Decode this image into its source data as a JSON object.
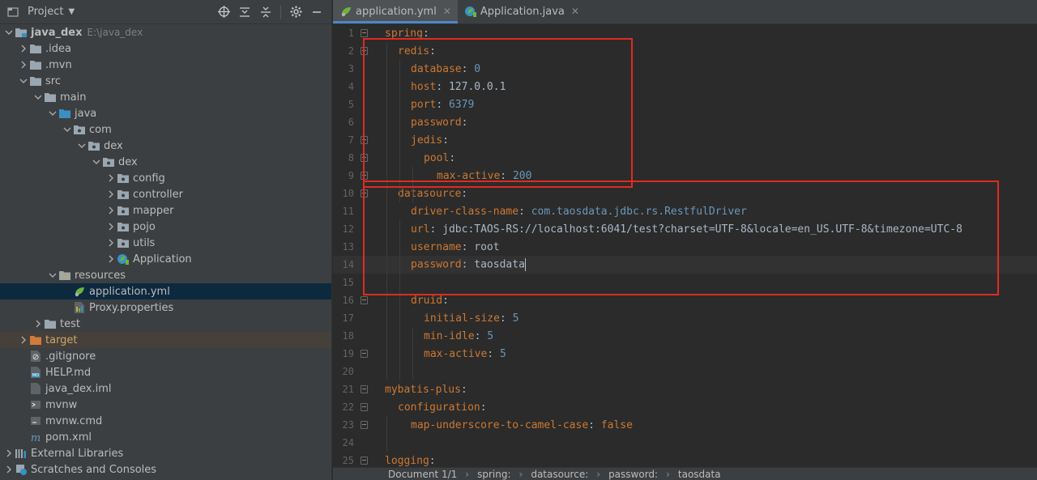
{
  "project_panel": {
    "title": "Project",
    "tree": [
      {
        "label": "java_dex",
        "path": "E:\\java_dex",
        "depth": 0,
        "expanded": true,
        "icon": "module-folder-icon",
        "bold": true
      },
      {
        "label": ".idea",
        "depth": 1,
        "expanded": false,
        "icon": "folder-icon"
      },
      {
        "label": ".mvn",
        "depth": 1,
        "expanded": false,
        "icon": "folder-icon"
      },
      {
        "label": "src",
        "depth": 1,
        "expanded": true,
        "icon": "folder-icon"
      },
      {
        "label": "main",
        "depth": 2,
        "expanded": true,
        "icon": "folder-icon"
      },
      {
        "label": "java",
        "depth": 3,
        "expanded": true,
        "icon": "source-folder-icon"
      },
      {
        "label": "com",
        "depth": 4,
        "expanded": true,
        "icon": "package-icon"
      },
      {
        "label": "dex",
        "depth": 5,
        "expanded": true,
        "icon": "package-icon"
      },
      {
        "label": "dex",
        "depth": 6,
        "expanded": true,
        "icon": "package-icon"
      },
      {
        "label": "config",
        "depth": 7,
        "expanded": false,
        "icon": "package-icon"
      },
      {
        "label": "controller",
        "depth": 7,
        "expanded": false,
        "icon": "package-icon"
      },
      {
        "label": "mapper",
        "depth": 7,
        "expanded": false,
        "icon": "package-icon"
      },
      {
        "label": "pojo",
        "depth": 7,
        "expanded": false,
        "icon": "package-icon"
      },
      {
        "label": "utils",
        "depth": 7,
        "expanded": false,
        "icon": "package-icon"
      },
      {
        "label": "Application",
        "depth": 7,
        "expanded": false,
        "icon": "spring-class-icon"
      },
      {
        "label": "resources",
        "depth": 3,
        "expanded": true,
        "icon": "resources-folder-icon"
      },
      {
        "label": "application.yml",
        "depth": 4,
        "icon": "yaml-file-icon",
        "selected": true
      },
      {
        "label": "Proxy.properties",
        "depth": 4,
        "icon": "properties-file-icon"
      },
      {
        "label": "test",
        "depth": 2,
        "expanded": false,
        "icon": "folder-icon"
      },
      {
        "label": "target",
        "depth": 1,
        "expanded": false,
        "icon": "excluded-folder-icon",
        "orange": true,
        "highlight": true
      },
      {
        "label": ".gitignore",
        "depth": 1,
        "icon": "gitignore-file-icon"
      },
      {
        "label": "HELP.md",
        "depth": 1,
        "icon": "markdown-file-icon"
      },
      {
        "label": "java_dex.iml",
        "depth": 1,
        "icon": "iml-file-icon"
      },
      {
        "label": "mvnw",
        "depth": 1,
        "icon": "shell-file-icon"
      },
      {
        "label": "mvnw.cmd",
        "depth": 1,
        "icon": "cmd-file-icon"
      },
      {
        "label": "pom.xml",
        "depth": 1,
        "icon": "maven-file-icon"
      },
      {
        "label": "External Libraries",
        "depth": 0,
        "expanded": false,
        "icon": "libraries-icon"
      },
      {
        "label": "Scratches and Consoles",
        "depth": 0,
        "expanded": false,
        "icon": "scratches-icon"
      }
    ]
  },
  "editor": {
    "tabs": [
      {
        "label": "application.yml",
        "active": true,
        "icon": "yaml-file-icon"
      },
      {
        "label": "Application.java",
        "active": false,
        "icon": "spring-class-icon"
      }
    ],
    "lines": [
      {
        "n": "1",
        "indent": 0,
        "key": "spring",
        "sep": ":",
        "fold": true
      },
      {
        "n": "2",
        "indent": 1,
        "key": "redis",
        "sep": ":",
        "fold": true
      },
      {
        "n": "3",
        "indent": 2,
        "key": "database",
        "sep": ": ",
        "value": "0",
        "vtype": "num"
      },
      {
        "n": "4",
        "indent": 2,
        "key": "host",
        "sep": ": ",
        "value": "127.0.0.1",
        "vtype": "str"
      },
      {
        "n": "5",
        "indent": 2,
        "key": "port",
        "sep": ": ",
        "value": "6379",
        "vtype": "num"
      },
      {
        "n": "6",
        "indent": 2,
        "key": "password",
        "sep": ":"
      },
      {
        "n": "7",
        "indent": 2,
        "key": "jedis",
        "sep": ":",
        "fold": true
      },
      {
        "n": "8",
        "indent": 3,
        "key": "pool",
        "sep": ":",
        "fold": true
      },
      {
        "n": "9",
        "indent": 4,
        "key": "max-active",
        "sep": ": ",
        "value": "200",
        "vtype": "num",
        "fold": true
      },
      {
        "n": "10",
        "indent": 1,
        "key": "datasource",
        "sep": ":",
        "fold": true
      },
      {
        "n": "11",
        "indent": 2,
        "key": "driver-class-name",
        "sep": ": ",
        "value": "com.taosdata.jdbc.rs.RestfulDriver",
        "vtype": "cls"
      },
      {
        "n": "12",
        "indent": 2,
        "key": "url",
        "sep": ": ",
        "value": "jdbc:TAOS-RS://localhost:6041/test?charset=UTF-8&locale=en_US.UTF-8&timezone=UTC-8",
        "vtype": "str"
      },
      {
        "n": "13",
        "indent": 2,
        "key": "username",
        "sep": ": ",
        "value": "root",
        "vtype": "str"
      },
      {
        "n": "14",
        "indent": 2,
        "key": "password",
        "sep": ": ",
        "value": "taosdata",
        "vtype": "str",
        "current": true
      },
      {
        "n": "15",
        "indent": 0,
        "key": ""
      },
      {
        "n": "16",
        "indent": 2,
        "key": "druid",
        "sep": ":",
        "fold": true
      },
      {
        "n": "17",
        "indent": 3,
        "key": "initial-size",
        "sep": ": ",
        "value": "5",
        "vtype": "num"
      },
      {
        "n": "18",
        "indent": 3,
        "key": "min-idle",
        "sep": ": ",
        "value": "5",
        "vtype": "num"
      },
      {
        "n": "19",
        "indent": 3,
        "key": "max-active",
        "sep": ": ",
        "value": "5",
        "vtype": "num",
        "fold": true
      },
      {
        "n": "20",
        "indent": 0,
        "key": ""
      },
      {
        "n": "21",
        "indent": 0,
        "key": "mybatis-plus",
        "sep": ":",
        "fold": true
      },
      {
        "n": "22",
        "indent": 1,
        "key": "configuration",
        "sep": ":",
        "fold": true
      },
      {
        "n": "23",
        "indent": 2,
        "key": "map-underscore-to-camel-case",
        "sep": ": ",
        "value": "false",
        "vtype": "kw",
        "fold": true
      },
      {
        "n": "24",
        "indent": 0,
        "key": ""
      },
      {
        "n": "25",
        "indent": 0,
        "key": "logging",
        "sep": ":",
        "fold": true
      }
    ]
  },
  "statusbar": {
    "breadcrumbs": [
      "Document 1/1",
      "spring:",
      "datasource:",
      "password:",
      "taosdata"
    ]
  },
  "colors": {
    "key": "#cc7832",
    "number": "#6897bb",
    "string": "#a9b7c6",
    "selection": "#0d293e",
    "annotation_box": "#e02b20"
  }
}
